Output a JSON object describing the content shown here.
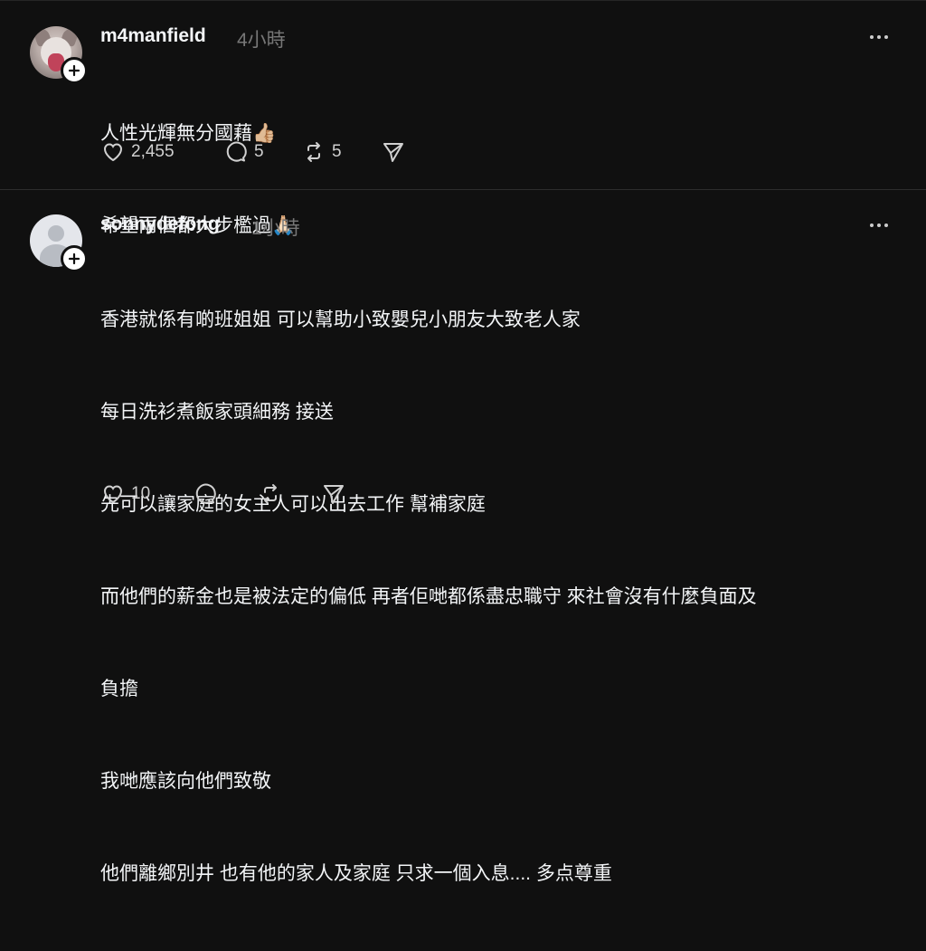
{
  "posts": [
    {
      "username": "m4manfield",
      "time": "4小時",
      "lines": [
        "人性光輝無分國藉👍🏼",
        "希望兩個都大步檻過🙏🏻"
      ],
      "likes": "2,455",
      "comments": "5",
      "reposts": "5"
    },
    {
      "username": "sonnydefong",
      "time": "1小時",
      "lines": [
        "香港就係有啲班姐姐 可以幫助小致嬰兒小朋友大致老人家",
        "每日洗衫煮飯家頭細務 接送",
        "先可以讓家庭的女主人可以出去工作 幫補家庭",
        "而他們的薪金也是被法定的偏低 再者佢哋都係盡忠職守 來社會沒有什麼負面及",
        "負擔",
        "我哋應該向他們致敬",
        "他們離鄉別井 也有他的家人及家庭 只求一個入息.... 多点尊重"
      ],
      "likes": "10"
    }
  ]
}
